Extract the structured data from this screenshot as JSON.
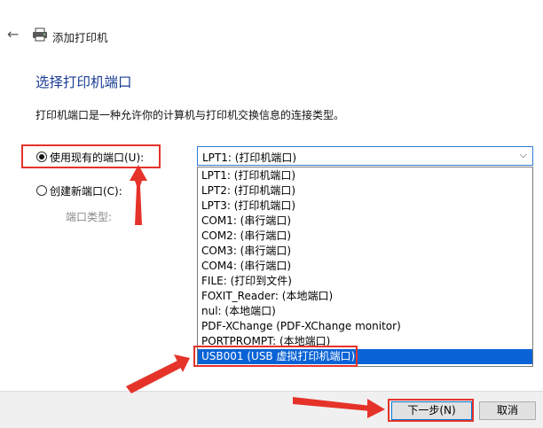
{
  "window": {
    "title": "添加打印机",
    "back_icon": "back-arrow-icon",
    "printer_icon": "printer-icon"
  },
  "page": {
    "heading": "选择打印机端口",
    "description": "打印机端口是一种允许你的计算机与打印机交换信息的连接类型。"
  },
  "options": {
    "use_existing_label": "使用现有的端口(U):",
    "use_existing_checked": true,
    "create_new_label": "创建新端口(C):",
    "create_new_checked": false,
    "port_type_label": "端口类型:"
  },
  "port_select": {
    "value": "LPT1: (打印机端口)",
    "items": [
      "LPT1: (打印机端口)",
      "LPT2: (打印机端口)",
      "LPT3: (打印机端口)",
      "COM1: (串行端口)",
      "COM2: (串行端口)",
      "COM3: (串行端口)",
      "COM4: (串行端口)",
      "FILE: (打印到文件)",
      "FOXIT_Reader: (本地端口)",
      "nul: (本地端口)",
      "PDF-XChange (PDF-XChange monitor)",
      "PORTPROMPT: (本地端口)",
      "USB001 (USB 虚拟打印机端口)"
    ],
    "selected_index": 12
  },
  "buttons": {
    "next_label": "下一步(N)",
    "cancel_label": "取消"
  },
  "colors": {
    "heading": "#1a3c94",
    "selection": "#0a63d6",
    "annotation": "#e5332a"
  }
}
